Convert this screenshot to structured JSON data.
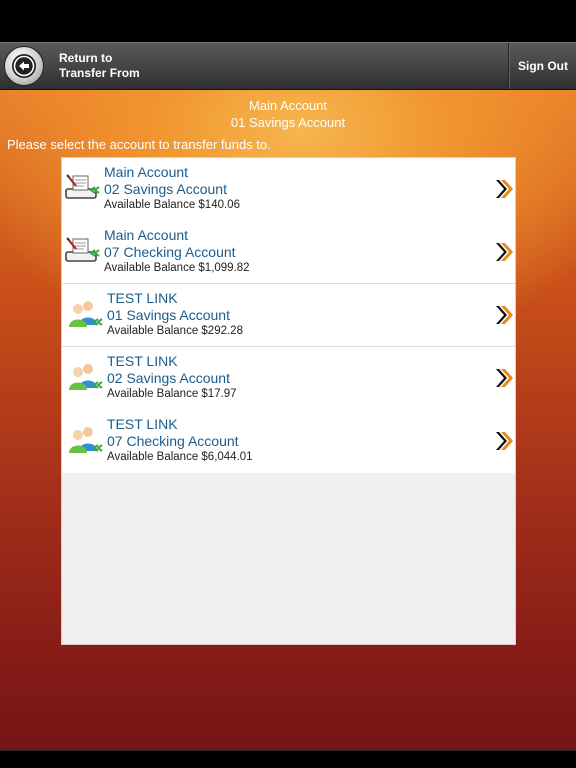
{
  "nav": {
    "back_line1": "Return to",
    "back_line2": "Transfer From",
    "sign_out": "Sign Out"
  },
  "header": {
    "from_owner": "Main Account",
    "from_account": "01 Savings Account",
    "instruction": "Please select the account to transfer funds to."
  },
  "accounts": [
    {
      "owner": "Main Account",
      "account": "02 Savings Account",
      "balance": "Available Balance $140.06",
      "icon": "document-transfer-icon"
    },
    {
      "owner": "Main Account",
      "account": "07 Checking Account",
      "balance": "Available Balance $1,099.82",
      "icon": "document-transfer-icon"
    },
    {
      "owner": "TEST LINK",
      "account": "01 Savings Account",
      "balance": "Available Balance $292.28",
      "icon": "users-transfer-icon"
    },
    {
      "owner": "TEST LINK",
      "account": "02 Savings Account",
      "balance": "Available Balance $17.97",
      "icon": "users-transfer-icon"
    },
    {
      "owner": "TEST LINK",
      "account": "07 Checking Account",
      "balance": "Available Balance $6,044.01",
      "icon": "users-transfer-icon"
    }
  ],
  "colors": {
    "link_blue": "#1c5c8c",
    "chevron_orange": "#e8891a",
    "arrow_green": "#3aa53a"
  }
}
